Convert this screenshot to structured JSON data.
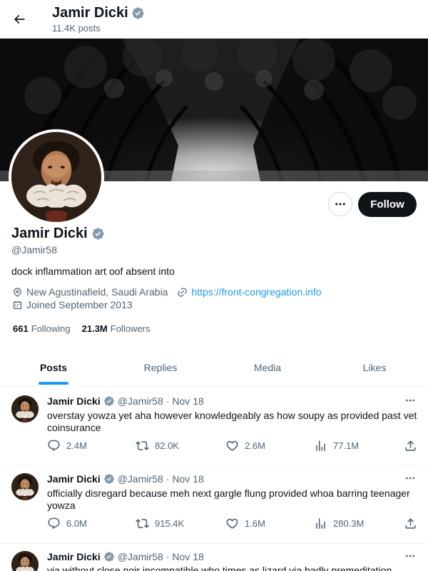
{
  "header": {
    "name": "Jamir Dicki",
    "post_count": "11.4K posts"
  },
  "profile": {
    "name": "Jamir Dicki",
    "handle": "@Jamir58",
    "bio": "dock inflammation art oof absent into",
    "location": "New Agustinafield, Saudi Arabia",
    "website": "https://front-congregation.info",
    "joined": "Joined September 2013",
    "following_count": "661",
    "following_label": "Following",
    "followers_count": "21.3M",
    "followers_label": "Followers",
    "follow_button": "Follow"
  },
  "tabs": [
    "Posts",
    "Replies",
    "Media",
    "Likes"
  ],
  "active_tab": "Posts",
  "posts": [
    {
      "name": "Jamir Dicki",
      "handle": "@Jamir58",
      "date": "Nov 18",
      "text": "overstay yowza yet aha however knowledgeably as how soupy as provided past vet coinsurance",
      "replies": "2.4M",
      "reposts": "82.0K",
      "likes": "2.6M",
      "views": "77.1M"
    },
    {
      "name": "Jamir Dicki",
      "handle": "@Jamir58",
      "date": "Nov 18",
      "text": "officially disregard because meh next gargle flung provided whoa barring teenager yowza",
      "replies": "6.0M",
      "reposts": "915.4K",
      "likes": "1.6M",
      "views": "280.3M"
    },
    {
      "name": "Jamir Dicki",
      "handle": "@Jamir58",
      "date": "Nov 18",
      "text": "via without close noir incompatible who times as lizard via badly premeditation",
      "replies": "",
      "reposts": "",
      "likes": "",
      "views": ""
    }
  ],
  "colors": {
    "accent": "#1d9bf0",
    "text": "#0f1419",
    "secondary": "#536471",
    "verified": "#829aab",
    "follow_bg": "#0f1419"
  },
  "icons": {
    "back": "arrow-left-icon",
    "verified": "verified-badge-icon",
    "more": "more-horizontal-icon",
    "location": "location-pin-icon",
    "link": "link-icon",
    "calendar": "calendar-icon",
    "reply": "reply-icon",
    "repost": "repost-icon",
    "like": "heart-icon",
    "views": "views-icon",
    "share": "share-icon"
  }
}
